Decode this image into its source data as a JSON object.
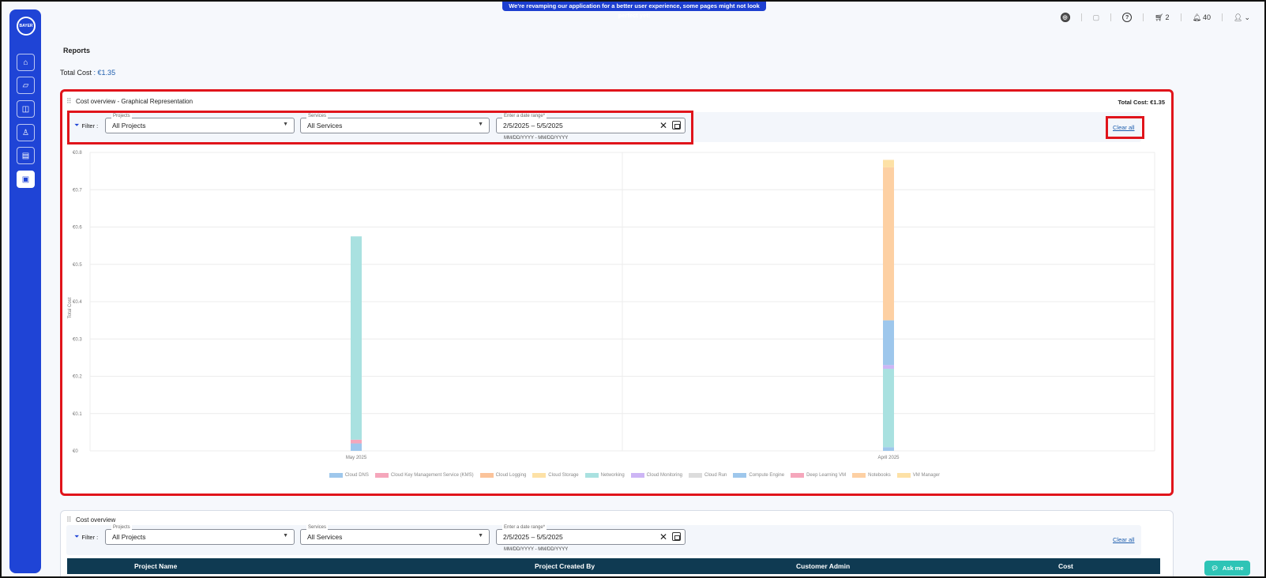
{
  "banner": {
    "text": "We're revamping our application for a better user experience, some pages might not look perfect yet!"
  },
  "sidebar": {
    "logo_text": "BAYER",
    "items": [
      {
        "icon": "home-icon",
        "active": false
      },
      {
        "icon": "folder-icon",
        "active": false
      },
      {
        "icon": "shopping-bag-icon",
        "active": false
      },
      {
        "icon": "user-settings-icon",
        "active": false
      },
      {
        "icon": "billing-icon",
        "active": false
      },
      {
        "icon": "reports-icon",
        "active": true
      }
    ]
  },
  "topbar": {
    "cart_count": "2",
    "notification_count": "40"
  },
  "page": {
    "title": "Reports",
    "total_cost_label": "Total Cost",
    "total_cost_value": ": €1.35"
  },
  "graph_panel": {
    "title": "Cost overview - Graphical Representation",
    "total_cost": "Total Cost: €1.35",
    "filter_label": "Filter :",
    "projects": {
      "label": "Projects",
      "value": "All Projects"
    },
    "services": {
      "label": "Services",
      "value": "All Services"
    },
    "date_range": {
      "label": "Enter a date range*",
      "start": "2/5/2025",
      "sep": "–",
      "end": "5/5/2025",
      "hint": "MM/DD/YYYY - MM/DD/YYYY"
    },
    "clear_all": "Clear all"
  },
  "table_panel": {
    "title": "Cost overview",
    "filter_label": "Filter :",
    "projects": {
      "label": "Projects",
      "value": "All Projects"
    },
    "services": {
      "label": "Services",
      "value": "All Services"
    },
    "date_range": {
      "label": "Enter a date range*",
      "start": "2/5/2025",
      "sep": "–",
      "end": "5/5/2025",
      "hint": "MM/DD/YYYY - MM/DD/YYYY"
    },
    "clear_all": "Clear all",
    "columns": [
      "Project Name",
      "Project Created By",
      "Customer Admin",
      "Cost"
    ]
  },
  "ask_me": "Ask me",
  "colors": {
    "brand": "#1f44d6",
    "highlight": "#e0141b",
    "table_header": "#0f3a52"
  },
  "chart_data": {
    "type": "bar",
    "stacked": true,
    "categories": [
      "May 2025",
      "April 2025"
    ],
    "ylabel": "Total Cost",
    "ylim": [
      0,
      0.8
    ],
    "yticks": [
      "€0",
      "€0.1",
      "€0.2",
      "€0.3",
      "€0.4",
      "€0.5",
      "€0.6",
      "€0.7",
      "€0.8"
    ],
    "grid": true,
    "legend_position": "bottom",
    "series": [
      {
        "name": "Cloud DNS",
        "color": "#9ec7ec",
        "values": [
          0.02,
          0.01
        ]
      },
      {
        "name": "Cloud Key Management Service (KMS)",
        "color": "#f5a6bb",
        "values": [
          0.01,
          0.0
        ]
      },
      {
        "name": "Cloud Logging",
        "color": "#fbc39a",
        "values": [
          0.0,
          0.0
        ]
      },
      {
        "name": "Cloud Storage",
        "color": "#fde1a6",
        "values": [
          0.0,
          0.0
        ]
      },
      {
        "name": "Networking",
        "color": "#a9e1e0",
        "values": [
          0.545,
          0.21
        ]
      },
      {
        "name": "Cloud Monitoring",
        "color": "#cdb5f5",
        "values": [
          0.0,
          0.01
        ]
      },
      {
        "name": "Cloud Run",
        "color": "#dcdcdc",
        "values": [
          0.0,
          0.0
        ]
      },
      {
        "name": "Compute Engine",
        "color": "#9ec7ec",
        "values": [
          0.0,
          0.12
        ]
      },
      {
        "name": "Deep Learning VM",
        "color": "#f5a6bb",
        "values": [
          0.0,
          0.0
        ]
      },
      {
        "name": "Notebooks",
        "color": "#fdd0a3",
        "values": [
          0.0,
          0.41
        ]
      },
      {
        "name": "VM Manager",
        "color": "#fde1a6",
        "values": [
          0.0,
          0.02
        ]
      }
    ]
  }
}
